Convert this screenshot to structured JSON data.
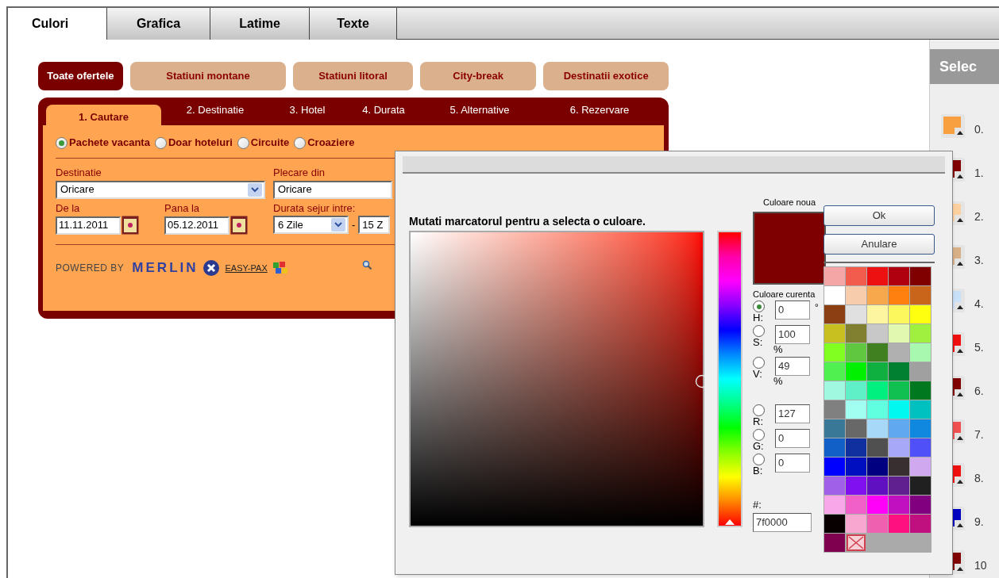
{
  "tabs": [
    {
      "label": "Culori",
      "selected": true
    },
    {
      "label": "Grafica",
      "selected": false
    },
    {
      "label": "Latime",
      "selected": false
    },
    {
      "label": "Texte",
      "selected": false
    }
  ],
  "widget": {
    "categories": [
      {
        "label": "Toate ofertele",
        "selected": true
      },
      {
        "label": "Statiuni montane",
        "selected": false
      },
      {
        "label": "Statiuni litoral",
        "selected": false
      },
      {
        "label": "City-break",
        "selected": false
      },
      {
        "label": "Destinatii exotice",
        "selected": false
      }
    ],
    "steps": [
      {
        "label": "1. Cautare",
        "selected": true
      },
      {
        "label": "2. Destinatie",
        "selected": false
      },
      {
        "label": "3. Hotel",
        "selected": false
      },
      {
        "label": "4. Durata",
        "selected": false
      },
      {
        "label": "5. Alternative",
        "selected": false
      },
      {
        "label": "6. Rezervare",
        "selected": false
      }
    ],
    "trip_types": [
      {
        "label": "Pachete vacanta",
        "selected": true
      },
      {
        "label": "Doar hoteluri",
        "selected": false
      },
      {
        "label": "Circuite",
        "selected": false
      },
      {
        "label": "Croaziere",
        "selected": false
      }
    ],
    "destination": {
      "label": "Destinatie",
      "value": "Oricare"
    },
    "departure": {
      "label": "Plecare din",
      "value": "Oricare"
    },
    "date_from": {
      "label": "De la",
      "value": "11.11.2011"
    },
    "date_to": {
      "label": "Pana la",
      "value": "05.12.2011"
    },
    "duration": {
      "label": "Durata sejur intre:",
      "min": "6 Zile",
      "separator": "-",
      "max": "15 Z"
    },
    "footer": {
      "powered_by": "POWERED BY",
      "brand": "MERLIN",
      "link": "EASY-PAX"
    }
  },
  "side_panel": {
    "title": "Selec",
    "items": [
      {
        "number": "0.",
        "color": "#f8a040"
      },
      {
        "number": "1.",
        "color": "#800000"
      },
      {
        "number": "2.",
        "color": "#fdd0a0"
      },
      {
        "number": "3.",
        "color": "#d8b088"
      },
      {
        "number": "4.",
        "color": "#c8e0f8"
      },
      {
        "number": "5.",
        "color": "#f01010"
      },
      {
        "number": "6.",
        "color": "#800000"
      },
      {
        "number": "7.",
        "color": "#f05050"
      },
      {
        "number": "8.",
        "color": "#f01010"
      },
      {
        "number": "9.",
        "color": "#0000c0"
      },
      {
        "number": "10",
        "color": "#800000"
      }
    ]
  },
  "color_dialog": {
    "instruction": "Mutati marcatorul pentru a selecta o culoare.",
    "new_color_label": "Culoare noua",
    "hue_slider": {
      "level": 0
    },
    "buttons": [
      "Ok",
      "Anulare"
    ],
    "current_color_label": "Culoare curenta",
    "channels": [
      {
        "label": "H:",
        "value": "0",
        "unit": "°",
        "selected": true
      },
      {
        "label": "S:",
        "value": "100",
        "unit": "%",
        "selected": false
      },
      {
        "label": "V:",
        "value": "49",
        "unit": "%",
        "selected": false
      },
      {
        "label": "R:",
        "value": "127",
        "selected": false
      },
      {
        "label": "G:",
        "value": "0",
        "selected": false
      },
      {
        "label": "B:",
        "value": "0",
        "selected": false
      }
    ],
    "hex_label": "#:",
    "hex_value": "7f0000",
    "palette": [
      {
        "kind": "swatch",
        "color": "#f4a6a6"
      },
      {
        "kind": "swatch",
        "color": "#f25c4c"
      },
      {
        "kind": "swatch",
        "color": "#ee1111"
      },
      {
        "kind": "swatch",
        "color": "#b00010"
      },
      {
        "kind": "swatch",
        "color": "#800000"
      },
      {
        "kind": "swatch",
        "color": "#ffffff"
      },
      {
        "kind": "swatch",
        "color": "#f7ccac"
      },
      {
        "kind": "swatch",
        "color": "#f7a84c"
      },
      {
        "kind": "swatch",
        "color": "#ff7f0f"
      },
      {
        "kind": "swatch",
        "color": "#c8651a"
      },
      {
        "kind": "swatch",
        "color": "#8b3f12"
      },
      {
        "kind": "swatch",
        "color": "#e0e0e0"
      },
      {
        "kind": "swatch",
        "color": "#fdf5a0"
      },
      {
        "kind": "swatch",
        "color": "#fbf75c"
      },
      {
        "kind": "swatch",
        "color": "#ffff10"
      },
      {
        "kind": "swatch",
        "color": "#c8c020"
      },
      {
        "kind": "swatch",
        "color": "#808030"
      },
      {
        "kind": "swatch",
        "color": "#c8c8c8"
      },
      {
        "kind": "swatch",
        "color": "#e0f8b0"
      },
      {
        "kind": "swatch",
        "color": "#a0f040"
      },
      {
        "kind": "swatch",
        "color": "#80ff20"
      },
      {
        "kind": "swatch",
        "color": "#60c840"
      },
      {
        "kind": "swatch",
        "color": "#408020"
      },
      {
        "kind": "swatch",
        "color": "#b0b0b0"
      },
      {
        "kind": "swatch",
        "color": "#a8f8b0"
      },
      {
        "kind": "swatch",
        "color": "#50f050"
      },
      {
        "kind": "swatch",
        "color": "#00f000"
      },
      {
        "kind": "swatch",
        "color": "#10b040"
      },
      {
        "kind": "swatch",
        "color": "#008030"
      },
      {
        "kind": "swatch",
        "color": "#a0a0a0"
      },
      {
        "kind": "swatch",
        "color": "#a0f8e0"
      },
      {
        "kind": "swatch",
        "color": "#60f0c8"
      },
      {
        "kind": "swatch",
        "color": "#00f080"
      },
      {
        "kind": "swatch",
        "color": "#10c050"
      },
      {
        "kind": "swatch",
        "color": "#007820"
      },
      {
        "kind": "swatch",
        "color": "#808080"
      },
      {
        "kind": "swatch",
        "color": "#a0fff0"
      },
      {
        "kind": "swatch",
        "color": "#60ffe0"
      },
      {
        "kind": "swatch",
        "color": "#00f8f0"
      },
      {
        "kind": "swatch",
        "color": "#00c0c0"
      },
      {
        "kind": "swatch",
        "color": "#3a7898"
      },
      {
        "kind": "swatch",
        "color": "#686868"
      },
      {
        "kind": "swatch",
        "color": "#a8d8f8"
      },
      {
        "kind": "swatch",
        "color": "#60a8f0"
      },
      {
        "kind": "swatch",
        "color": "#1088e0"
      },
      {
        "kind": "swatch",
        "color": "#1060c8"
      },
      {
        "kind": "swatch",
        "color": "#1030a0"
      },
      {
        "kind": "swatch",
        "color": "#505050"
      },
      {
        "kind": "swatch",
        "color": "#a8a8f8"
      },
      {
        "kind": "swatch",
        "color": "#5050f8"
      },
      {
        "kind": "swatch",
        "color": "#0000ff"
      },
      {
        "kind": "swatch",
        "color": "#0010c0"
      },
      {
        "kind": "swatch",
        "color": "#000080"
      },
      {
        "kind": "swatch",
        "color": "#383030"
      },
      {
        "kind": "swatch",
        "color": "#d0a8f0"
      },
      {
        "kind": "swatch",
        "color": "#a060e8"
      },
      {
        "kind": "swatch",
        "color": "#8010f0"
      },
      {
        "kind": "swatch",
        "color": "#6010c0"
      },
      {
        "kind": "swatch",
        "color": "#602090"
      },
      {
        "kind": "swatch",
        "color": "#202020"
      },
      {
        "kind": "swatch",
        "color": "#f8a8e8"
      },
      {
        "kind": "swatch",
        "color": "#f060c8"
      },
      {
        "kind": "swatch",
        "color": "#ff00f8"
      },
      {
        "kind": "swatch",
        "color": "#c010c0"
      },
      {
        "kind": "swatch",
        "color": "#800080"
      },
      {
        "kind": "swatch",
        "color": "#080000"
      },
      {
        "kind": "swatch",
        "color": "#f8a8d0"
      },
      {
        "kind": "swatch",
        "color": "#f060b0"
      },
      {
        "kind": "swatch",
        "color": "#ff1080"
      },
      {
        "kind": "swatch",
        "color": "#c01080"
      },
      {
        "kind": "swatch",
        "color": "#800050"
      },
      {
        "kind": "clear"
      }
    ]
  }
}
